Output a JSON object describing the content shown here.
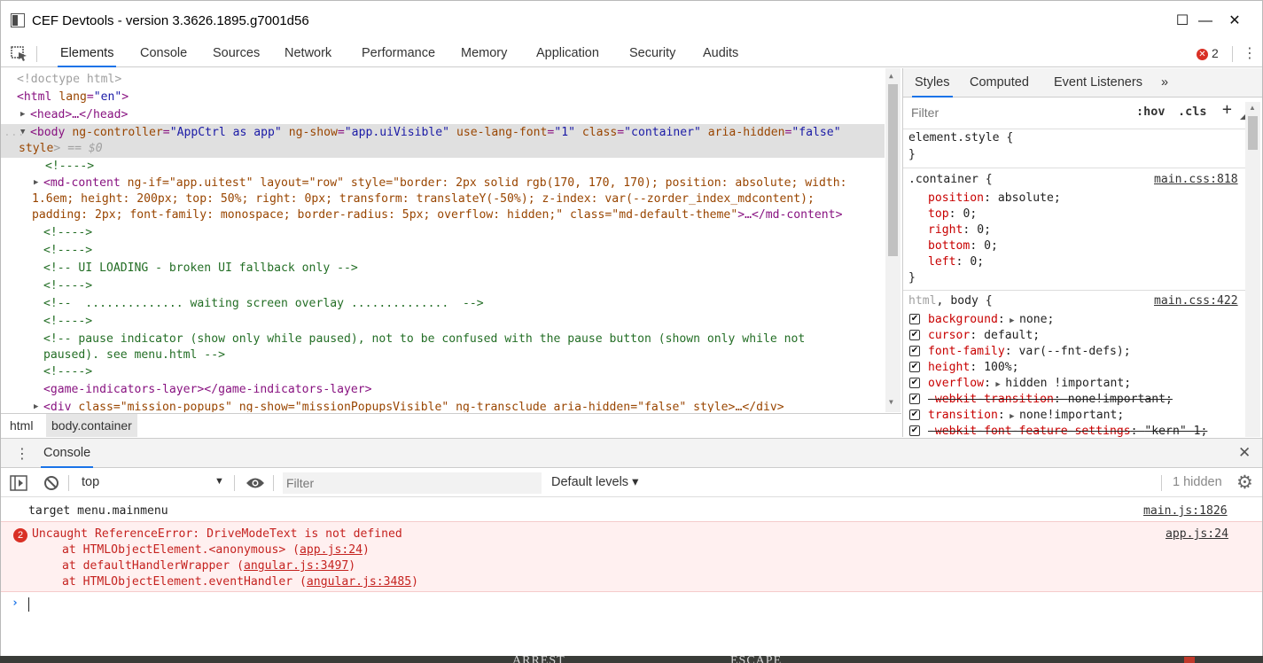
{
  "window": {
    "title": "CEF Devtools - version 3.3626.1895.g7001d56",
    "minimize": "—",
    "maximize": "☐",
    "close": "✕"
  },
  "tabs": [
    "Elements",
    "Console",
    "Sources",
    "Network",
    "Performance",
    "Memory",
    "Application",
    "Security",
    "Audits"
  ],
  "error_count": "2",
  "dom": {
    "doctype": "<!doctype html>",
    "html_open": "<html",
    "html_lang_attr": "lang",
    "html_lang_val": "\"en\"",
    "html_close": ">",
    "head": "<head>…</head>",
    "body_line1_tag": "<body",
    "body_line1_attrs": [
      {
        "name": "ng-controller",
        "value": "\"AppCtrl as app\""
      },
      {
        "name": "ng-show",
        "value": "\"app.uiVisible\""
      },
      {
        "name": "use-lang-font",
        "value": "\"1\""
      },
      {
        "name": "class",
        "value": "\"container\""
      },
      {
        "name": "aria-hidden",
        "value": "\"false\""
      }
    ],
    "body_line2_attr": "style",
    "body_line2_rest": "> == $0",
    "c1": "<!---->",
    "mdcontent_l1_tag": "<md-content",
    "mdcontent_l1": " ng-if=\"app.uitest\" layout=\"row\" style=\"border: 2px solid rgb(170, 170, 170); position: absolute; width:",
    "mdcontent_l2": "1.6em; height: 200px; top: 50%; right: 0px; transform: translateY(-50%); z-index: var(--zorder_index_mdcontent);",
    "mdcontent_l3": "padding: 2px; font-family: monospace; border-radius: 5px; overflow: hidden;\"",
    "mdcontent_l3_class": " class=\"md-default-theme\"",
    "mdcontent_l3_end": ">…</md-content>",
    "c2": "<!---->",
    "c3": "<!---->",
    "c4": "<!-- UI LOADING - broken UI fallback only -->",
    "c5": "<!---->",
    "c6": "<!--  .............. waiting screen overlay ..............  -->",
    "c7": "<!---->",
    "c8a": "<!-- pause indicator (show only while paused), not to be confused with the pause button (shown only while not",
    "c8b": "paused). see menu.html -->",
    "c9": "<!---->",
    "gil": "<game-indicators-layer></game-indicators-layer>",
    "div_tag": "<div",
    "div_attrs": " class=\"mission-popups\" ng-show=\"missionPopupsVisible\" ng-transclude aria-hidden=\"false\" style>…</div>"
  },
  "breadcrumbs": [
    "html",
    "body.container"
  ],
  "styles": {
    "tabs": [
      "Styles",
      "Computed",
      "Event Listeners",
      "»"
    ],
    "filter_placeholder": "Filter",
    "hov": ":hov",
    "cls": ".cls",
    "plus": "+",
    "element_style": "element.style {",
    "close_brace": "}",
    "rule1": {
      "selector": ".container {",
      "source": "main.css:818",
      "props": [
        {
          "name": "position",
          "value": "absolute;"
        },
        {
          "name": "top",
          "value": "0;"
        },
        {
          "name": "right",
          "value": "0;"
        },
        {
          "name": "bottom",
          "value": "0;"
        },
        {
          "name": "left",
          "value": "0;"
        }
      ]
    },
    "rule2": {
      "selector_a": "html",
      "selector_b": ", body {",
      "source": "main.css:422",
      "props": [
        {
          "name": "background",
          "value": "none;",
          "arrow": true,
          "struck": false
        },
        {
          "name": "cursor",
          "value": "default;",
          "arrow": false,
          "struck": false
        },
        {
          "name": "font-family",
          "value": "var(--fnt-defs);",
          "arrow": false,
          "struck": false
        },
        {
          "name": "height",
          "value": "100%;",
          "arrow": false,
          "struck": false
        },
        {
          "name": "overflow",
          "value": "hidden !important;",
          "arrow": true,
          "struck": false
        },
        {
          "name": "-webkit-transition",
          "value": "none!important;",
          "arrow": false,
          "struck": true
        },
        {
          "name": "transition",
          "value": "none!important;",
          "arrow": true,
          "struck": false
        },
        {
          "name": "-webkit-font-feature-settings",
          "value": "\"kern\" 1;",
          "arrow": false,
          "struck": true
        }
      ]
    }
  },
  "console": {
    "drawer_tab": "Console",
    "context": "top",
    "filter_placeholder": "Filter",
    "levels": "Default levels ▾",
    "hidden": "1 hidden",
    "log1": {
      "text": "target menu.mainmenu",
      "source": "main.js:1826"
    },
    "error": {
      "count": "2",
      "message": "Uncaught ReferenceError: DriveModeText is not defined",
      "source": "app.js:24",
      "stack": [
        {
          "pre": "at HTMLObjectElement.<anonymous> (",
          "link": "app.js:24",
          "post": ")"
        },
        {
          "pre": "at defaultHandlerWrapper (",
          "link": "angular.js:3497",
          "post": ")"
        },
        {
          "pre": "at HTMLObjectElement.eventHandler (",
          "link": "angular.js:3485",
          "post": ")"
        }
      ]
    },
    "prompt": "›"
  },
  "background_text": [
    "ARREST",
    "ESCAPE"
  ],
  "colors": {
    "accent": "#1a73e8",
    "error": "#c5221f",
    "error_bg": "#fff0f0"
  }
}
